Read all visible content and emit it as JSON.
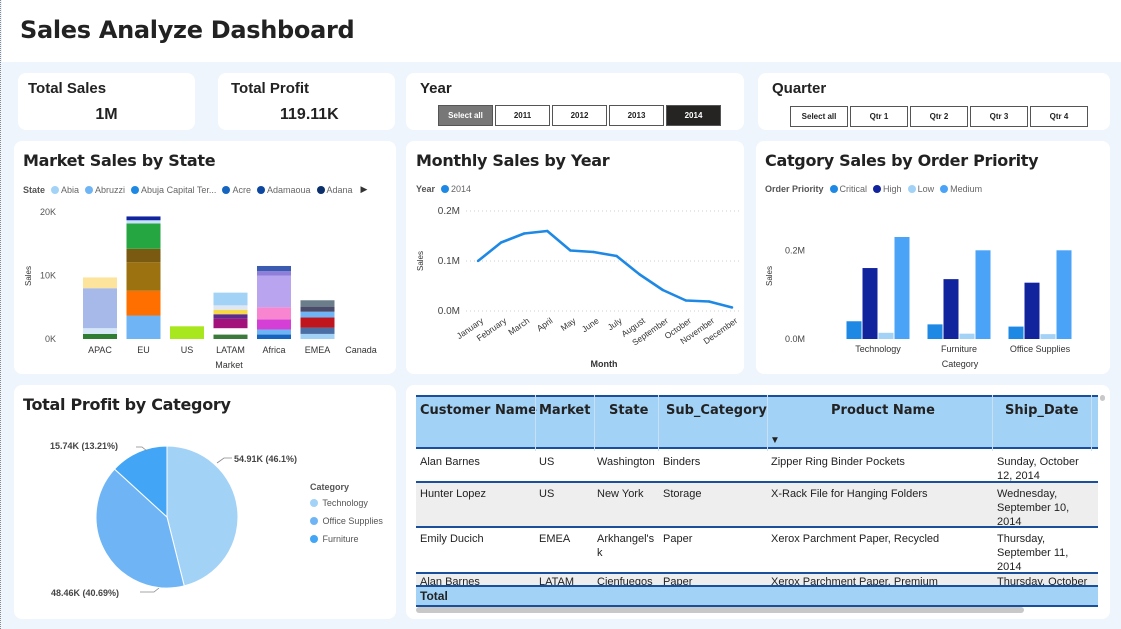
{
  "title": "Sales Analyze Dashboard",
  "kpis": {
    "total_sales": {
      "label": "Total Sales",
      "value": "1M"
    },
    "total_profit": {
      "label": "Total Profit",
      "value": "119.11K"
    }
  },
  "year_slicer": {
    "title": "Year",
    "options": [
      "Select all",
      "2011",
      "2012",
      "2013",
      "2014"
    ],
    "selected": "2014"
  },
  "quarter_slicer": {
    "title": "Quarter",
    "options": [
      "Select all",
      "Qtr 1",
      "Qtr 2",
      "Qtr 3",
      "Qtr 4"
    ]
  },
  "colors": {
    "accent": "#1e88e5",
    "dark_blue": "#12239e",
    "light_blue": "#a3d2f7",
    "mid_blue": "#4aa3f7",
    "header_border": "#1a4f9c"
  },
  "market_chart": {
    "title": "Market Sales by State",
    "legend_title": "State",
    "legend": [
      {
        "name": "Abia",
        "color": "#a3d2f7"
      },
      {
        "name": "Abruzzi",
        "color": "#6fb5f5"
      },
      {
        "name": "Abuja Capital Ter...",
        "color": "#1e88e5"
      },
      {
        "name": "Acre",
        "color": "#1565c0"
      },
      {
        "name": "Adamaoua",
        "color": "#0d47a1"
      },
      {
        "name": "Adana",
        "color": "#0a2f6b"
      }
    ],
    "y_ticks": [
      "20K",
      "10K",
      "0K"
    ],
    "y_label": "Sales",
    "x_label": "Market"
  },
  "monthly_chart": {
    "title": "Monthly Sales by Year",
    "legend_title": "Year",
    "legend_item": "2014",
    "y_ticks": [
      "0.2M",
      "0.1M",
      "0.0M"
    ],
    "y_label": "Sales",
    "x_label": "Month"
  },
  "priority_chart": {
    "title": "Catgory Sales by Order Priority",
    "legend_title": "Order Priority",
    "legend": [
      {
        "name": "Critical",
        "color": "#1e88e5"
      },
      {
        "name": "High",
        "color": "#12239e"
      },
      {
        "name": "Low",
        "color": "#a3d2f7"
      },
      {
        "name": "Medium",
        "color": "#4aa3f7"
      }
    ],
    "y_ticks": [
      "0.2M",
      "0.0M"
    ],
    "y_label": "Sales",
    "x_label": "Category"
  },
  "pie_chart": {
    "title": "Total Profit by Category",
    "legend_title": "Category",
    "labels": [
      "54.91K (46.1%)",
      "48.46K (40.69%)",
      "15.74K (13.21%)"
    ]
  },
  "table": {
    "headers": [
      "Customer Name",
      "Market",
      "State",
      "Sub_Category",
      "Product Name",
      "Ship_Date"
    ],
    "rows": [
      [
        "Alan Barnes",
        "US",
        "Washington",
        "Binders",
        "Zipper Ring Binder Pockets",
        "Sunday, October 12, 2014"
      ],
      [
        "Hunter Lopez",
        "US",
        "New York",
        "Storage",
        "X-Rack File for Hanging Folders",
        "Wednesday, September 10, 2014"
      ],
      [
        "Emily Ducich",
        "EMEA",
        "Arkhangel's k",
        "Paper",
        "Xerox Parchment Paper, Recycled",
        "Thursday, September 11, 2014"
      ],
      [
        "Alan Barnes",
        "LATAM",
        "Cienfuegos",
        "Paper",
        "Xerox Parchment Paper, Premium",
        "Thursday, October"
      ]
    ],
    "total_label": "Total"
  },
  "chart_data": [
    {
      "type": "bar",
      "stacked": true,
      "title": "Market Sales by State",
      "xlabel": "Market",
      "ylabel": "Sales",
      "ylim": [
        0,
        20000
      ],
      "categories": [
        "APAC",
        "EU",
        "US",
        "LATAM",
        "Africa",
        "EMEA",
        "Canada"
      ],
      "stacks": [
        {
          "category": "APAC",
          "segments": [
            {
              "value": 800,
              "color": "#2e7d32"
            },
            {
              "value": 900,
              "color": "#d6e8f7"
            },
            {
              "value": 6300,
              "color": "#a7b9e8"
            },
            {
              "value": 1700,
              "color": "#fde49c"
            }
          ]
        },
        {
          "category": "EU",
          "segments": [
            {
              "value": 3700,
              "color": "#6fb5f5"
            },
            {
              "value": 3900,
              "color": "#ff6f00"
            },
            {
              "value": 4500,
              "color": "#9c7110"
            },
            {
              "value": 2100,
              "color": "#7a5a10"
            },
            {
              "value": 4000,
              "color": "#26a640"
            },
            {
              "value": 500,
              "color": "#c7e3f9"
            },
            {
              "value": 600,
              "color": "#12239e"
            }
          ]
        },
        {
          "category": "US",
          "segments": [
            {
              "value": 2000,
              "color": "#a8e61d"
            }
          ]
        },
        {
          "category": "LATAM",
          "segments": [
            {
              "value": 700,
              "color": "#3b7a3b"
            },
            {
              "value": 1000,
              "color": "#ffffff"
            },
            {
              "value": 1500,
              "color": "#a3127a"
            },
            {
              "value": 700,
              "color": "#5b2c8e"
            },
            {
              "value": 700,
              "color": "#f5d94a"
            },
            {
              "value": 700,
              "color": "#dfe7f2"
            },
            {
              "value": 2000,
              "color": "#a3d2f7"
            }
          ]
        },
        {
          "category": "Africa",
          "segments": [
            {
              "value": 700,
              "color": "#1565c0"
            },
            {
              "value": 800,
              "color": "#6fb5f5"
            },
            {
              "value": 1600,
              "color": "#d63fd6"
            },
            {
              "value": 1900,
              "color": "#f785d0"
            },
            {
              "value": 5000,
              "color": "#b9a4f0"
            },
            {
              "value": 700,
              "color": "#8f7fd8"
            },
            {
              "value": 800,
              "color": "#3a5bb0"
            }
          ]
        },
        {
          "category": "EMEA",
          "segments": [
            {
              "value": 800,
              "color": "#a3d2f7"
            },
            {
              "value": 1000,
              "color": "#4a6fa5"
            },
            {
              "value": 1600,
              "color": "#c0151d"
            },
            {
              "value": 900,
              "color": "#6fb5f5"
            },
            {
              "value": 800,
              "color": "#4a4a6a"
            },
            {
              "value": 1000,
              "color": "#6b7d8a"
            }
          ]
        },
        {
          "category": "Canada",
          "segments": []
        }
      ]
    },
    {
      "type": "line",
      "title": "Monthly Sales by Year",
      "xlabel": "Month",
      "ylabel": "Sales",
      "ylim": [
        0,
        200000
      ],
      "x": [
        "January",
        "February",
        "March",
        "April",
        "May",
        "June",
        "July",
        "August",
        "September",
        "October",
        "November",
        "December"
      ],
      "series": [
        {
          "name": "2014",
          "values": [
            100000,
            137000,
            155000,
            160000,
            121000,
            118000,
            110000,
            73000,
            42000,
            21000,
            19000,
            7000
          ]
        }
      ]
    },
    {
      "type": "bar",
      "title": "Catgory Sales by Order Priority",
      "xlabel": "Category",
      "ylabel": "Sales",
      "ylim": [
        0,
        250000
      ],
      "categories": [
        "Technology",
        "Furniture",
        "Office Supplies"
      ],
      "series": [
        {
          "name": "Critical",
          "values": [
            40000,
            33000,
            28000
          ]
        },
        {
          "name": "High",
          "values": [
            160000,
            135000,
            127000
          ]
        },
        {
          "name": "Low",
          "values": [
            14000,
            12000,
            11000
          ]
        },
        {
          "name": "Medium",
          "values": [
            262000,
            200000,
            200000
          ]
        }
      ]
    },
    {
      "type": "pie",
      "title": "Total Profit by Category",
      "categories": [
        "Technology",
        "Office Supplies",
        "Furniture"
      ],
      "values": [
        54910,
        48460,
        15740
      ],
      "labels": [
        "54.91K (46.1%)",
        "48.46K (40.69%)",
        "15.74K (13.21%)"
      ],
      "colors": [
        "#a3d2f7",
        "#6fb5f5",
        "#42a5f5"
      ]
    }
  ]
}
